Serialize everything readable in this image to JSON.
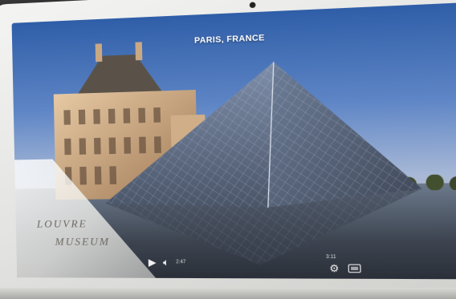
{
  "video": {
    "location": "PARIS, FRANCE",
    "title_line_1": "LOUVRE",
    "title_line_2": "MUSEUM",
    "current_time": "2:47",
    "duration": "3:11"
  },
  "icons": {
    "play": "play-icon",
    "volume": "volume-icon",
    "settings": "gear-icon",
    "fullscreen": "fullscreen-icon"
  },
  "colors": {
    "sky_top": "#2f5ea8",
    "bezel": "#f4f4f2",
    "control_text": "#f2f2f2"
  }
}
